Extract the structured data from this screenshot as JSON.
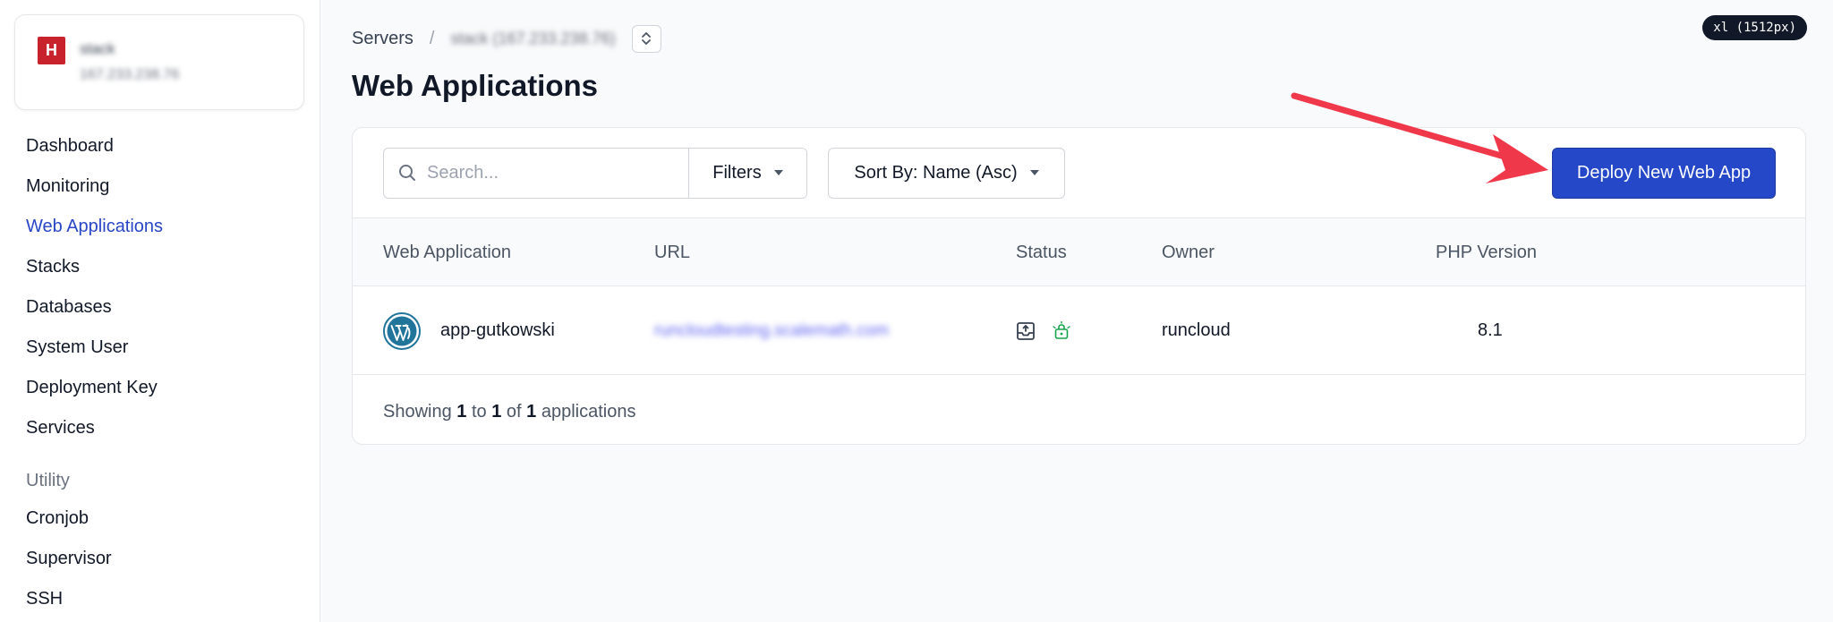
{
  "server": {
    "logo_letter": "H",
    "name": "stack",
    "ip": "167.233.238.76"
  },
  "sidebar": {
    "items": [
      {
        "label": "Dashboard"
      },
      {
        "label": "Monitoring"
      },
      {
        "label": "Web Applications"
      },
      {
        "label": "Stacks"
      },
      {
        "label": "Databases"
      },
      {
        "label": "System User"
      },
      {
        "label": "Deployment Key"
      },
      {
        "label": "Services"
      }
    ],
    "utility_heading": "Utility",
    "utility_items": [
      {
        "label": "Cronjob"
      },
      {
        "label": "Supervisor"
      },
      {
        "label": "SSH"
      }
    ]
  },
  "breadcrumb": {
    "root": "Servers",
    "separator": "/",
    "current": "stack (167.233.238.76)"
  },
  "page": {
    "title": "Web Applications",
    "screen_badge": "xl (1512px)"
  },
  "toolbar": {
    "search_placeholder": "Search...",
    "filters_label": "Filters",
    "sort_label": "Sort By: Name (Asc)",
    "deploy_label": "Deploy New Web App"
  },
  "table": {
    "headers": {
      "app": "Web Application",
      "url": "URL",
      "status": "Status",
      "owner": "Owner",
      "php": "PHP Version"
    },
    "rows": [
      {
        "name": "app-gutkowski",
        "url": "runcloudtesting.scalemath.com",
        "owner": "runcloud",
        "php": "8.1"
      }
    ]
  },
  "footer": {
    "prefix": "Showing",
    "from": "1",
    "to_word": "to",
    "to": "1",
    "of_word": "of",
    "total": "1",
    "suffix": "applications"
  },
  "colors": {
    "accent": "#2846c6",
    "deploy_button": "#2548c8",
    "logo_red": "#c8232c",
    "arrow": "#f0384b"
  }
}
